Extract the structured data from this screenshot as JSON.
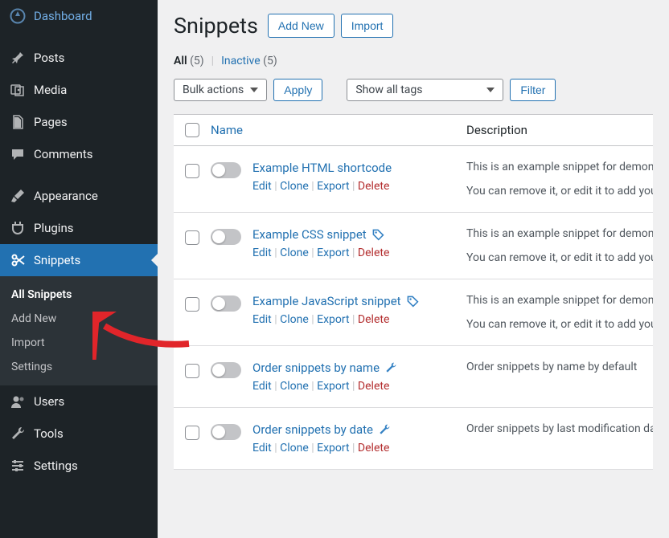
{
  "sidebar": {
    "items": [
      {
        "label": "Dashboard"
      },
      {
        "label": "Posts"
      },
      {
        "label": "Media"
      },
      {
        "label": "Pages"
      },
      {
        "label": "Comments"
      },
      {
        "label": "Appearance"
      },
      {
        "label": "Plugins"
      },
      {
        "label": "Snippets"
      },
      {
        "label": "Users"
      },
      {
        "label": "Tools"
      },
      {
        "label": "Settings"
      }
    ],
    "submenu": {
      "items": [
        {
          "label": "All Snippets"
        },
        {
          "label": "Add New"
        },
        {
          "label": "Import"
        },
        {
          "label": "Settings"
        }
      ]
    }
  },
  "page": {
    "title": "Snippets",
    "add_new": "Add New",
    "import": "Import"
  },
  "filters": {
    "all_label": "All",
    "all_count": "(5)",
    "inactive_label": "Inactive",
    "inactive_count": "(5)",
    "sep": "|"
  },
  "tablenav": {
    "bulk": "Bulk actions",
    "apply": "Apply",
    "tags": "Show all tags",
    "filter": "Filter"
  },
  "table": {
    "col_name": "Name",
    "col_desc": "Description",
    "actions": {
      "edit": "Edit",
      "clone": "Clone",
      "export": "Export",
      "delete": "Delete",
      "sep": " | "
    },
    "rows": [
      {
        "title": "Example HTML shortcode",
        "desc1": "This is an example snippet for demonstrating",
        "desc2": "You can remove it, or edit it to add your own",
        "has_type_icon": false,
        "has_wrench": false
      },
      {
        "title": "Example CSS snippet",
        "desc1": "This is an example snippet for demonstrating",
        "desc2": "You can remove it, or edit it to add your own",
        "has_type_icon": true,
        "has_wrench": false
      },
      {
        "title": "Example JavaScript snippet",
        "desc1": "This is an example snippet for demonstrating",
        "desc2": "You can remove it, or edit it to add your own",
        "has_type_icon": true,
        "has_wrench": false
      },
      {
        "title": "Order snippets by name",
        "desc": "Order snippets by name by default",
        "has_type_icon": false,
        "has_wrench": true
      },
      {
        "title": "Order snippets by date",
        "desc": "Order snippets by last modification date",
        "has_type_icon": false,
        "has_wrench": true
      }
    ]
  }
}
